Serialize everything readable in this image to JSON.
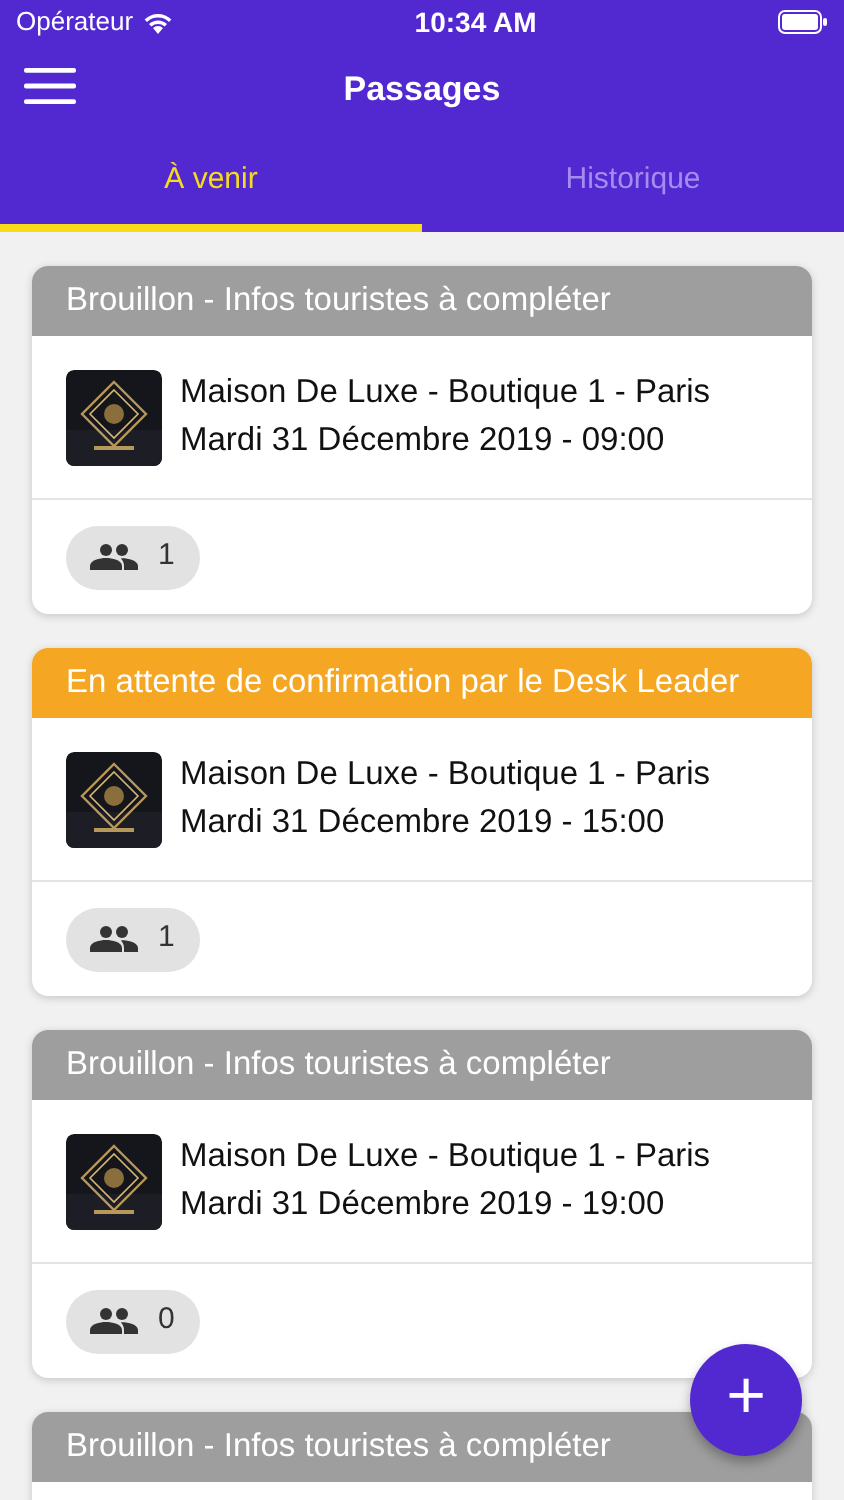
{
  "status_bar": {
    "carrier": "Opérateur",
    "time": "10:34 AM"
  },
  "header": {
    "title": "Passages"
  },
  "tabs": [
    {
      "label": "À venir",
      "selected": true
    },
    {
      "label": "Historique",
      "selected": false
    }
  ],
  "passages": [
    {
      "status": "Brouillon - Infos touristes à compléter",
      "color": "#9e9e9e",
      "place": "Maison De Luxe - Boutique 1 - Paris",
      "date": "Mardi 31 Décembre 2019 - 09:00",
      "people": "1"
    },
    {
      "status": "En attente de confirmation par le Desk Leader",
      "color": "#f5a623",
      "place": "Maison De Luxe - Boutique 1 - Paris",
      "date": "Mardi 31 Décembre 2019 - 15:00",
      "people": "1"
    },
    {
      "status": "Brouillon - Infos touristes à compléter",
      "color": "#9e9e9e",
      "place": "Maison De Luxe - Boutique 1 - Paris",
      "date": "Mardi 31 Décembre 2019 - 19:00",
      "people": "0"
    },
    {
      "status": "Brouillon - Infos touristes à compléter",
      "color": "#9e9e9e"
    }
  ],
  "fab": {
    "label": "+"
  }
}
